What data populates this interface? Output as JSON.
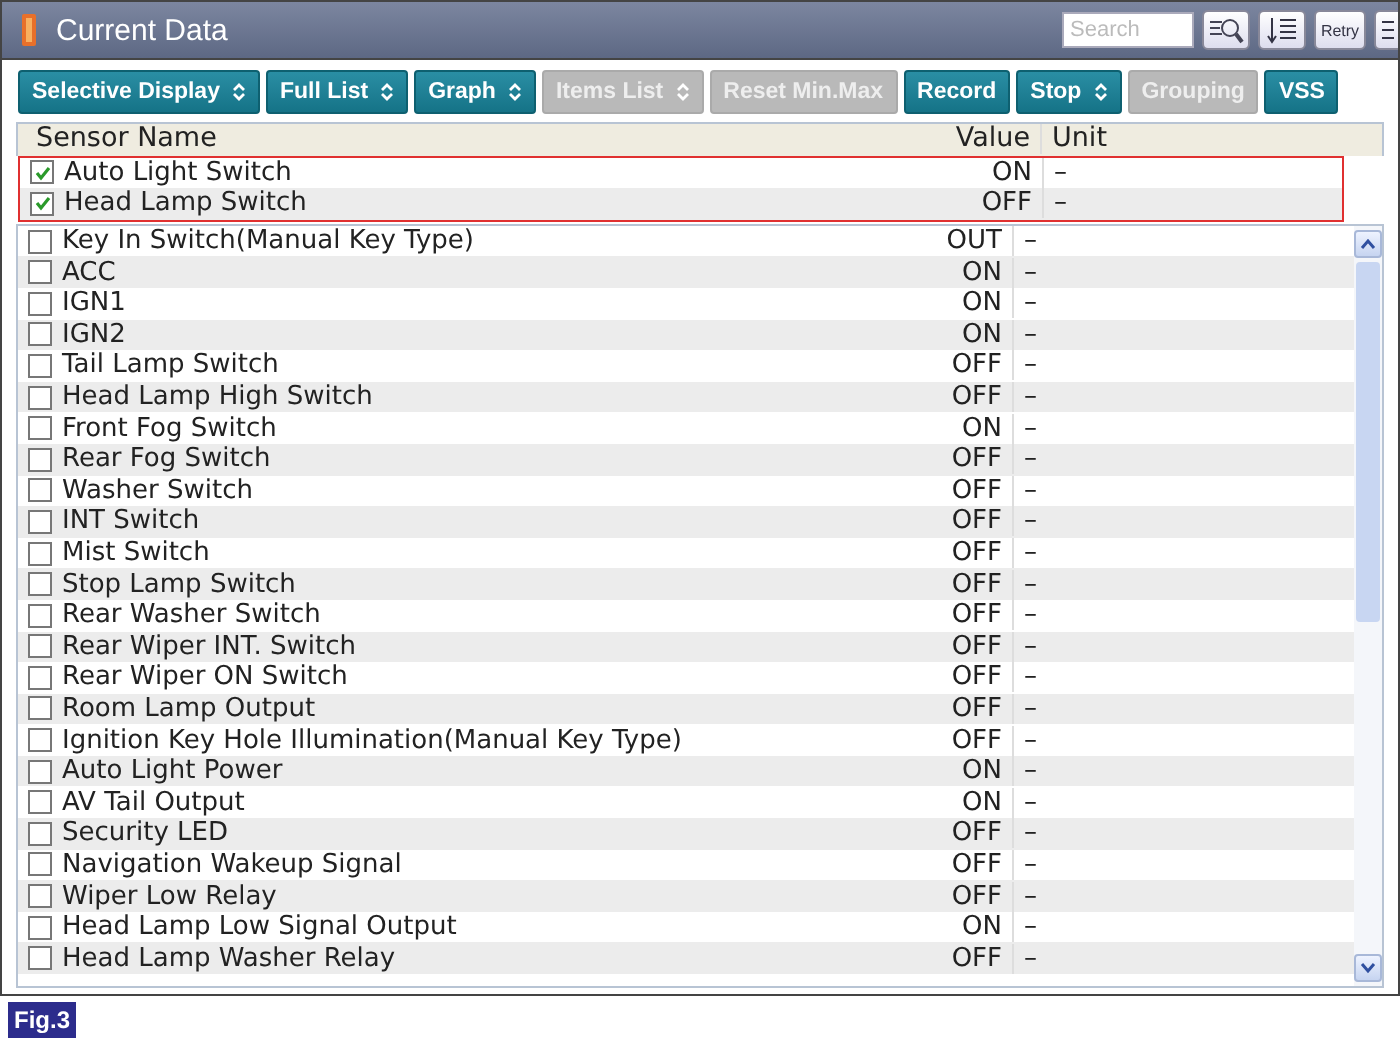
{
  "window": {
    "title": "Current Data"
  },
  "search": {
    "placeholder": "Search"
  },
  "retry_label": "Retry",
  "toolbar": [
    {
      "label": "Selective Display",
      "dropdown": true,
      "disabled": false
    },
    {
      "label": "Full List",
      "dropdown": true,
      "disabled": false
    },
    {
      "label": "Graph",
      "dropdown": true,
      "disabled": false
    },
    {
      "label": "Items List",
      "dropdown": true,
      "disabled": true
    },
    {
      "label": "Reset Min.Max",
      "dropdown": false,
      "disabled": true
    },
    {
      "label": "Record",
      "dropdown": false,
      "disabled": false
    },
    {
      "label": "Stop",
      "dropdown": true,
      "disabled": false
    },
    {
      "label": "Grouping",
      "dropdown": false,
      "disabled": true
    },
    {
      "label": "VSS",
      "dropdown": false,
      "disabled": false
    }
  ],
  "table": {
    "columns": [
      "Sensor Name",
      "Value",
      "Unit"
    ],
    "pinned_rows": [
      {
        "name": "Auto Light Switch",
        "checked": true,
        "value": "ON",
        "unit": "–"
      },
      {
        "name": "Head Lamp Switch",
        "checked": true,
        "value": "OFF",
        "unit": "–"
      }
    ],
    "rows": [
      {
        "name": "Key In Switch(Manual Key Type)",
        "checked": false,
        "value": "OUT",
        "unit": "–"
      },
      {
        "name": "ACC",
        "checked": false,
        "value": "ON",
        "unit": "–"
      },
      {
        "name": "IGN1",
        "checked": false,
        "value": "ON",
        "unit": "–"
      },
      {
        "name": "IGN2",
        "checked": false,
        "value": "ON",
        "unit": "–"
      },
      {
        "name": "Tail Lamp Switch",
        "checked": false,
        "value": "OFF",
        "unit": "–"
      },
      {
        "name": "Head Lamp High Switch",
        "checked": false,
        "value": "OFF",
        "unit": "–"
      },
      {
        "name": "Front Fog Switch",
        "checked": false,
        "value": "ON",
        "unit": "–"
      },
      {
        "name": "Rear Fog Switch",
        "checked": false,
        "value": "OFF",
        "unit": "–"
      },
      {
        "name": "Washer Switch",
        "checked": false,
        "value": "OFF",
        "unit": "–"
      },
      {
        "name": "INT Switch",
        "checked": false,
        "value": "OFF",
        "unit": "–"
      },
      {
        "name": "Mist Switch",
        "checked": false,
        "value": "OFF",
        "unit": "–"
      },
      {
        "name": "Stop Lamp Switch",
        "checked": false,
        "value": "OFF",
        "unit": "–"
      },
      {
        "name": "Rear Washer Switch",
        "checked": false,
        "value": "OFF",
        "unit": "–"
      },
      {
        "name": "Rear Wiper INT. Switch",
        "checked": false,
        "value": "OFF",
        "unit": "–"
      },
      {
        "name": "Rear Wiper ON Switch",
        "checked": false,
        "value": "OFF",
        "unit": "–"
      },
      {
        "name": "Room Lamp Output",
        "checked": false,
        "value": "OFF",
        "unit": "–"
      },
      {
        "name": "Ignition Key Hole Illumination(Manual Key Type)",
        "checked": false,
        "value": "OFF",
        "unit": "–"
      },
      {
        "name": "Auto Light Power",
        "checked": false,
        "value": "ON",
        "unit": "–"
      },
      {
        "name": "AV Tail Output",
        "checked": false,
        "value": "ON",
        "unit": "–"
      },
      {
        "name": "Security LED",
        "checked": false,
        "value": "OFF",
        "unit": "–"
      },
      {
        "name": "Navigation Wakeup Signal",
        "checked": false,
        "value": "OFF",
        "unit": "–"
      },
      {
        "name": "Wiper Low Relay",
        "checked": false,
        "value": "OFF",
        "unit": "–"
      },
      {
        "name": "Head Lamp Low Signal Output",
        "checked": false,
        "value": "ON",
        "unit": "–"
      },
      {
        "name": "Head Lamp Washer Relay",
        "checked": false,
        "value": "OFF",
        "unit": "–"
      }
    ]
  },
  "figure_label": "Fig.3"
}
